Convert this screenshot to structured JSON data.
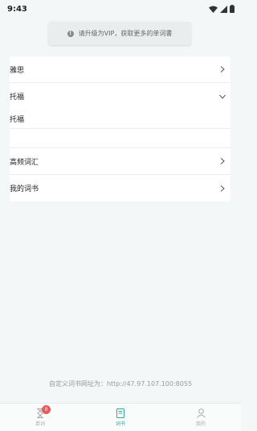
{
  "status_bar": {
    "time": "9:43"
  },
  "vip_banner": {
    "text": "请升级为VIP，获取更多的单词書"
  },
  "list": {
    "items": [
      {
        "label": "雅思",
        "expanded": false
      },
      {
        "label": "托福",
        "expanded": true,
        "children": [
          "托福",
          ""
        ]
      },
      {
        "label": "高频词汇",
        "expanded": false
      },
      {
        "label": "我的词书",
        "expanded": false
      }
    ]
  },
  "footer": {
    "url_text": "自定义词书网址为：http://47.97.107.100:8055"
  },
  "tabbar": {
    "tabs": [
      {
        "label": "单词",
        "icon": "hourglass-icon",
        "badge": "0",
        "active": false
      },
      {
        "label": "词书",
        "icon": "book-icon",
        "active": true
      },
      {
        "label": "我的",
        "icon": "person-icon",
        "active": false
      }
    ]
  },
  "colors": {
    "accent": "#35a4a8",
    "background": "#f3f7f7",
    "badge": "#e65a5a"
  }
}
